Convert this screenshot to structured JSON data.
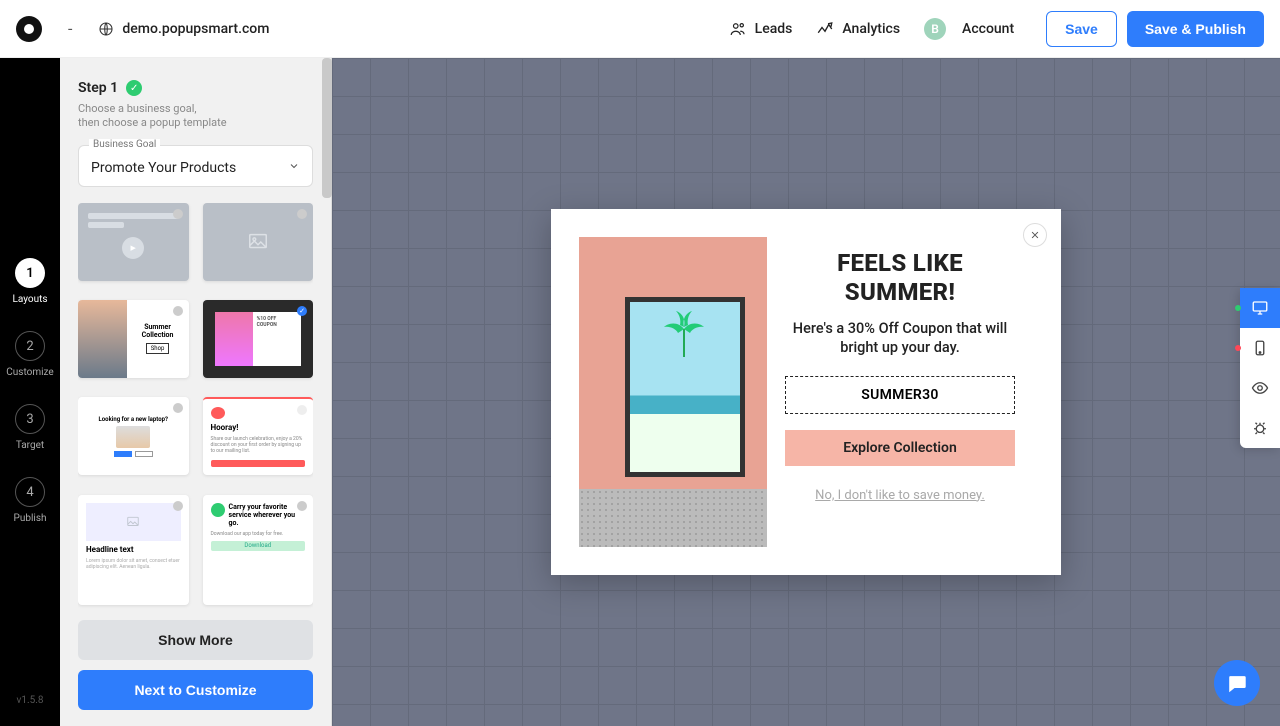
{
  "topbar": {
    "dash": "-",
    "site_url": "demo.popupsmart.com",
    "leads": "Leads",
    "analytics": "Analytics",
    "account": "Account",
    "account_initial": "B",
    "save": "Save",
    "save_publish": "Save & Publish"
  },
  "rail": {
    "steps": [
      {
        "num": "1",
        "label": "Layouts"
      },
      {
        "num": "2",
        "label": "Customize"
      },
      {
        "num": "3",
        "label": "Target"
      },
      {
        "num": "4",
        "label": "Publish"
      }
    ],
    "version": "v1.5.8"
  },
  "panel": {
    "step_title": "Step 1",
    "step_desc_1": "Choose a business goal,",
    "step_desc_2": "then choose a popup template",
    "goal_label": "Business Goal",
    "goal_value": "Promote Your Products",
    "templates": {
      "t3": {
        "title": "Summer Collection",
        "btn": "Shop"
      },
      "t4": {
        "label": "%10 OFF COUPON"
      },
      "t5": {
        "title": "Looking for a new laptop?"
      },
      "t6": {
        "title": "Hooray!",
        "desc": "Share our launch celebration, enjoy a 20% discount on your first order by signing up to our mailing list.",
        "cta": "Sign up now"
      },
      "t7": {
        "title": "Headline text",
        "desc": "Lorem ipsum dolor sit amet, consect etuer adipiscing elit. Aenean ligula."
      },
      "t8": {
        "title": "Carry your favorite service wherever you go.",
        "desc": "Download our app today for free.",
        "cta": "Download"
      }
    },
    "show_more": "Show More",
    "next": "Next to Customize"
  },
  "popup": {
    "title_1": "FEELS LIKE",
    "title_2": "SUMMER!",
    "desc": "Here's a 30% Off Coupon that will bright up your day.",
    "code": "SUMMER30",
    "cta": "Explore Collection",
    "decline": "No, I don't like to save money."
  }
}
